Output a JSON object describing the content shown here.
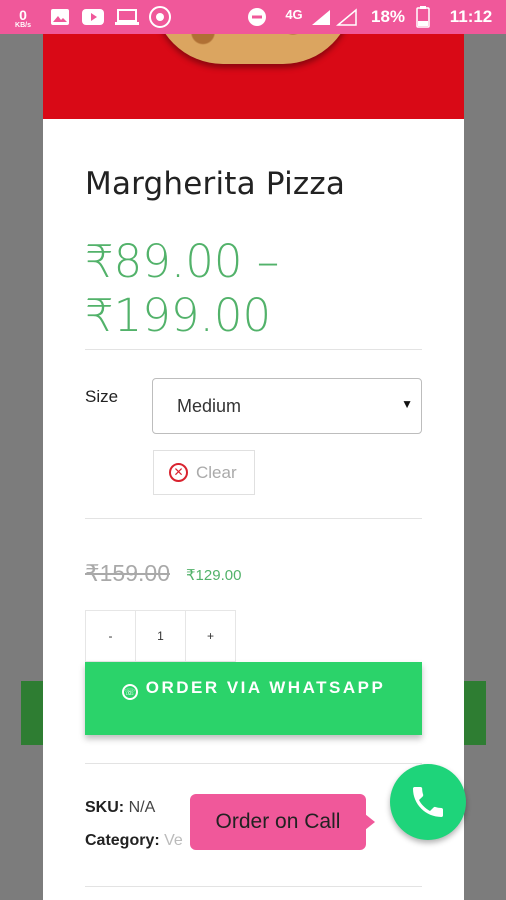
{
  "status_bar": {
    "network_speed": "0",
    "network_unit": "KB/s",
    "network_type": "4G",
    "battery": "18%",
    "time": "11:12",
    "icons": [
      "gallery-icon",
      "youtube-icon",
      "laptop-icon",
      "browser-icon",
      "dnd-icon",
      "signal-icon",
      "battery-icon"
    ]
  },
  "product": {
    "name": "Margherita Pizza",
    "price_range": "₹89.00 – ₹199.00",
    "variation": {
      "label": "Size",
      "selected": "Medium",
      "clear_label": "Clear"
    },
    "regular_price": "₹159.00",
    "sale_price": "₹129.00",
    "quantity": {
      "minus": "-",
      "value": "1",
      "plus": "+"
    },
    "order_button": "ORDER VIA WHATSAPP",
    "sku_label": "SKU:",
    "sku_value": "N/A",
    "category_label": "Category:",
    "category_value": "Ve"
  },
  "call_widget": {
    "label": "Order on Call"
  },
  "colors": {
    "status_bar": "#f0589a",
    "hero": "#d90916",
    "price_green": "#52b26a",
    "whatsapp_green": "#2bd36a",
    "call_green": "#1ed47a"
  }
}
